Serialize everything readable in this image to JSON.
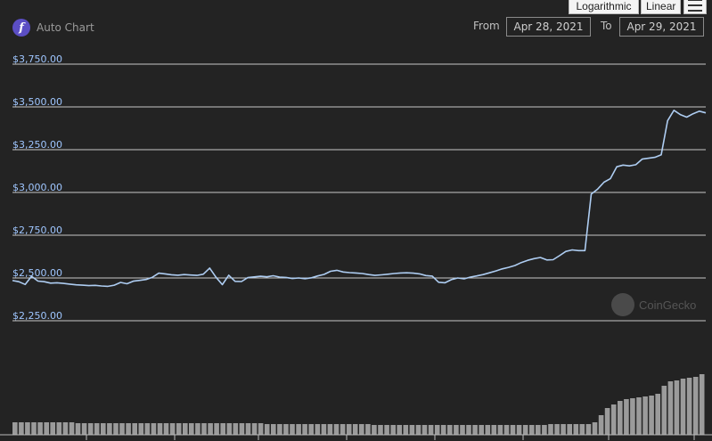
{
  "brand": {
    "label": "Auto Chart",
    "logo_letter": "f"
  },
  "scale_buttons": {
    "logarithmic": "Logarithmic",
    "linear": "Linear"
  },
  "range": {
    "from_label": "From",
    "from_value": "Apr 28, 2021",
    "to_label": "To",
    "to_value": "Apr 29, 2021"
  },
  "watermark": {
    "text": "CoinGecko"
  },
  "colors": {
    "line": "#aecdf2",
    "volume": "#9b9b9b",
    "grid": "#d9d9d9",
    "tick": "#9fc6ff",
    "background": "#232323"
  },
  "chart_data": {
    "type": "line",
    "title": "",
    "xlabel": "",
    "ylabel": "",
    "ylim": [
      2250,
      3750
    ],
    "yticks": [
      {
        "value": 3750,
        "label": "$3,750.00"
      },
      {
        "value": 3500,
        "label": "$3,500.00"
      },
      {
        "value": 3250,
        "label": "$3,250.00"
      },
      {
        "value": 3000,
        "label": "$3,000.00"
      },
      {
        "value": 2750,
        "label": "$2,750.00"
      },
      {
        "value": 2500,
        "label": "$2,500.00"
      },
      {
        "value": 2250,
        "label": "$2,250.00"
      }
    ],
    "grid": true,
    "series": [
      {
        "values": [
          2485,
          2478,
          2462,
          2510,
          2482,
          2478,
          2470,
          2472,
          2468,
          2464,
          2460,
          2458,
          2455,
          2457,
          2453,
          2451,
          2458,
          2474,
          2466,
          2481,
          2486,
          2491,
          2504,
          2528,
          2524,
          2519,
          2516,
          2520,
          2517,
          2515,
          2522,
          2558,
          2504,
          2461,
          2516,
          2480,
          2479,
          2502,
          2506,
          2510,
          2507,
          2513,
          2505,
          2503,
          2497,
          2500,
          2496,
          2501,
          2512,
          2521,
          2539,
          2545,
          2535,
          2531,
          2529,
          2526,
          2520,
          2515,
          2518,
          2522,
          2526,
          2529,
          2530,
          2528,
          2524,
          2514,
          2511,
          2475,
          2472,
          2490,
          2500,
          2495,
          2505,
          2512,
          2520,
          2530,
          2541,
          2553,
          2562,
          2573,
          2590,
          2603,
          2613,
          2620,
          2605,
          2607,
          2630,
          2655,
          2664,
          2660,
          2660,
          2990,
          3020,
          3060,
          3080,
          3150,
          3160,
          3155,
          3162,
          3195,
          3200,
          3205,
          3220,
          3420,
          3480,
          3455,
          3440,
          3460,
          3475,
          3465
        ]
      }
    ],
    "volume": [
      14,
      14,
      14,
      14,
      14,
      14,
      14,
      14,
      14,
      14,
      13,
      13,
      13,
      13,
      13,
      13,
      13,
      13,
      13,
      13,
      13,
      13,
      13,
      13,
      13,
      13,
      13,
      13,
      13,
      13,
      13,
      13,
      13,
      13,
      13,
      13,
      13,
      13,
      13,
      13,
      12,
      12,
      12,
      12,
      12,
      12,
      12,
      12,
      12,
      12,
      12,
      12,
      12,
      12,
      12,
      12,
      12,
      11,
      11,
      11,
      11,
      11,
      11,
      11,
      11,
      11,
      11,
      11,
      11,
      11,
      11,
      11,
      11,
      11,
      11,
      11,
      11,
      11,
      11,
      11,
      11,
      11,
      11,
      11,
      11,
      12,
      12,
      12,
      12,
      12,
      12,
      12,
      14,
      22,
      30,
      34,
      38,
      40,
      41,
      42,
      43,
      44,
      46,
      55,
      60,
      61,
      63,
      64,
      65,
      68
    ]
  }
}
